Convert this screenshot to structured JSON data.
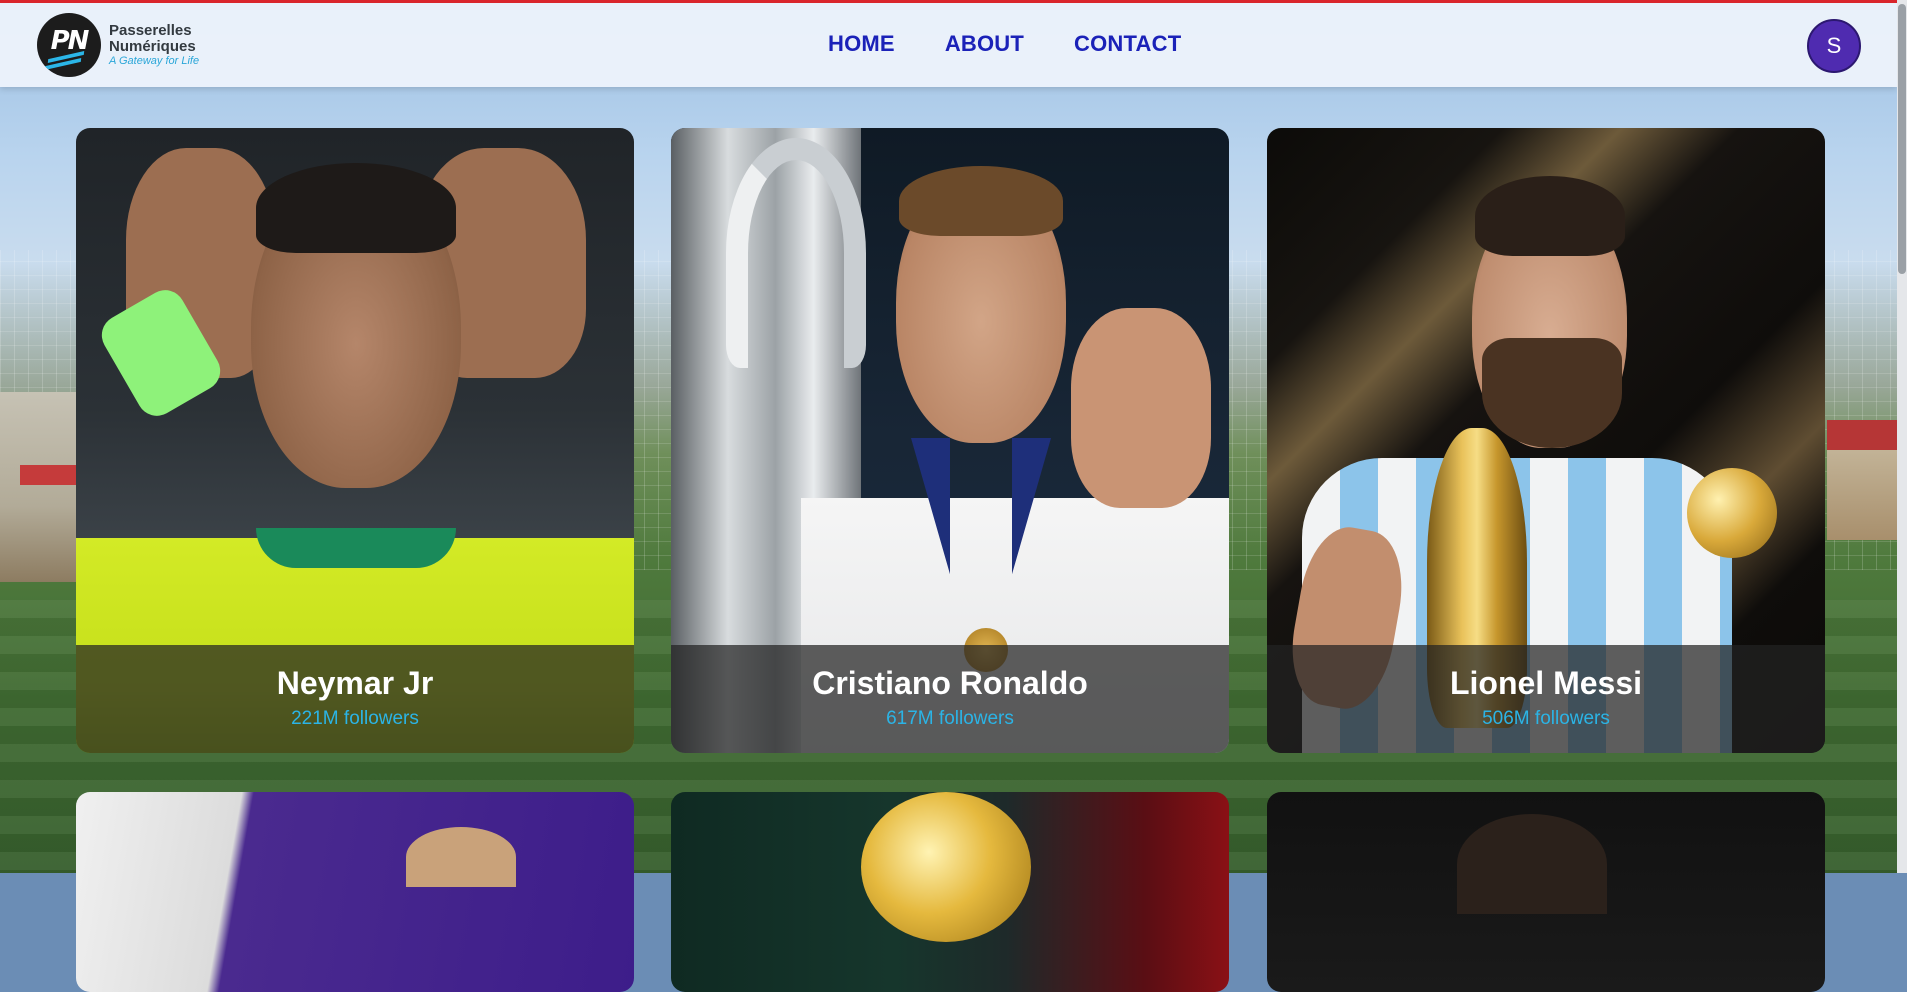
{
  "brand": {
    "logo_mark": "PN",
    "line1": "Passerelles",
    "line2": "Numériques",
    "tagline": "A Gateway for Life"
  },
  "nav": {
    "home": "HOME",
    "about": "ABOUT",
    "contact": "CONTACT"
  },
  "user": {
    "avatar_initial": "S"
  },
  "colors": {
    "nav_link": "#1b22b8",
    "avatar_bg": "#4f2bb0",
    "followers": "#2bb4e6",
    "top_strip": "#d9252b"
  },
  "players": [
    {
      "name": "Neymar Jr",
      "followers": "221M followers"
    },
    {
      "name": "Cristiano Ronaldo",
      "followers": "617M followers"
    },
    {
      "name": "Lionel Messi",
      "followers": "506M followers"
    }
  ]
}
